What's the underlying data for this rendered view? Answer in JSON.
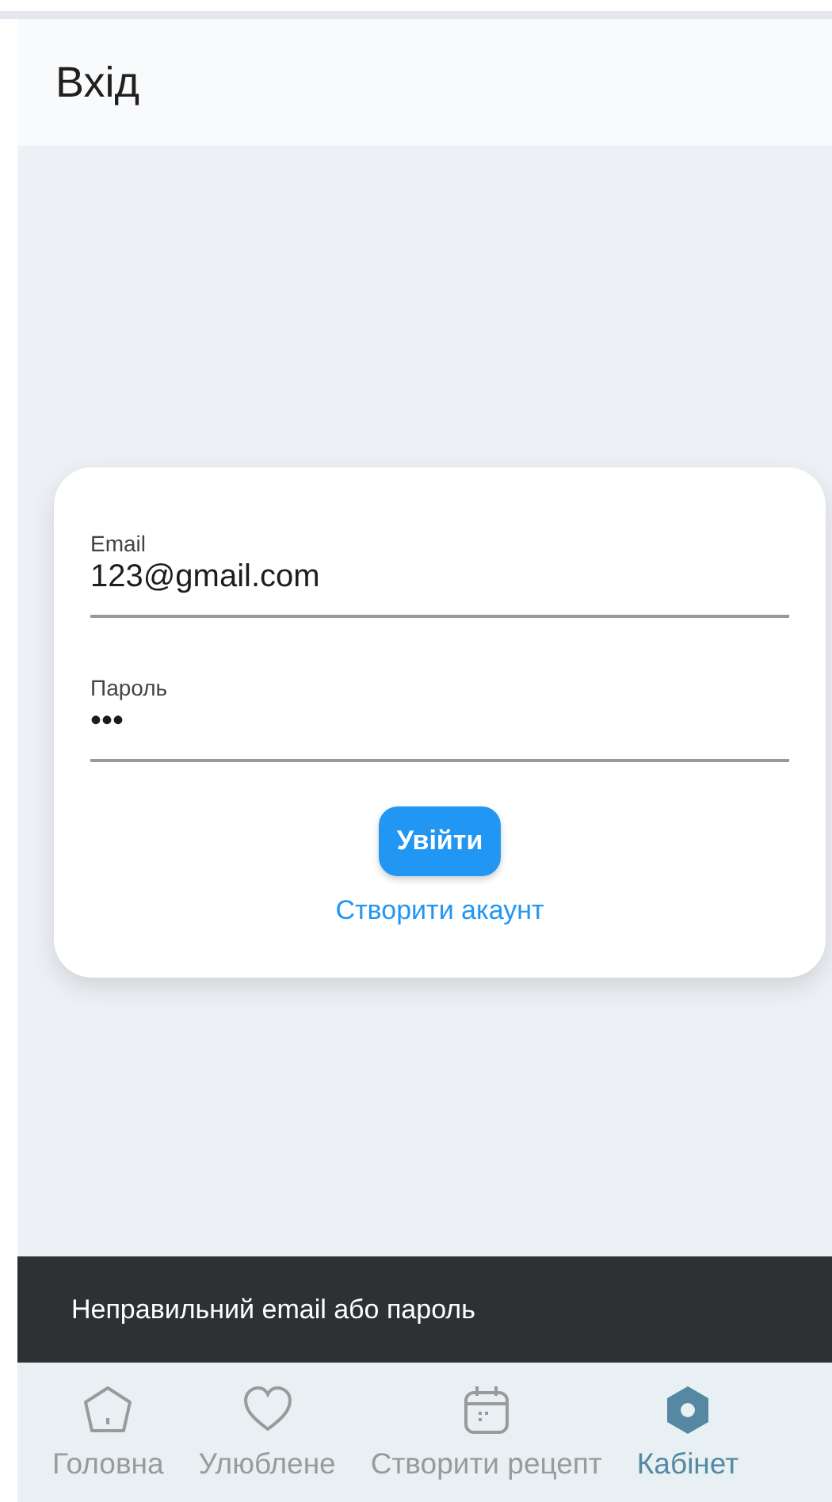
{
  "app_bar": {
    "title": "Вхід"
  },
  "form": {
    "fields": [
      {
        "label": "Email",
        "value": "123@gmail.com"
      },
      {
        "label": "Пароль",
        "value": "•••"
      }
    ],
    "submit": "Увійти",
    "link": "Створити акаунт"
  },
  "snackbar": {
    "message": "Неправильний email або пароль"
  },
  "nav": [
    {
      "kind": "home",
      "label": "Головна",
      "selected": false
    },
    {
      "kind": "heart",
      "label": "Улюблене",
      "selected": false
    },
    {
      "kind": "calendar",
      "label": "Створити рецепт",
      "selected": false
    },
    {
      "kind": "hexagon",
      "label": "Кабінет",
      "selected": true
    }
  ]
}
